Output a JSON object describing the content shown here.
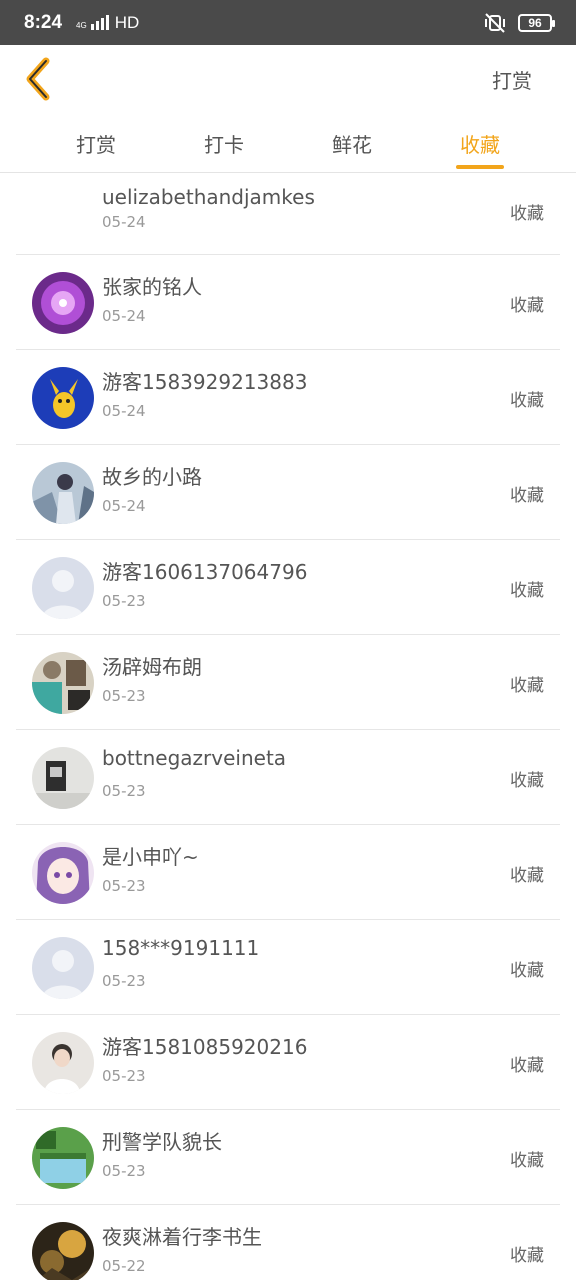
{
  "status_bar": {
    "time": "8:24",
    "network_small": "4G",
    "hd": "HD",
    "battery": "96"
  },
  "header": {
    "action_label": "打赏"
  },
  "tabs": [
    {
      "label": "打赏",
      "active": false
    },
    {
      "label": "打卡",
      "active": false
    },
    {
      "label": "鲜花",
      "active": false
    },
    {
      "label": "收藏",
      "active": true
    }
  ],
  "colors": {
    "accent": "#f2a51b",
    "status_bar_bg": "#4a4a4a"
  },
  "list": [
    {
      "name": "uelizabethandjamkes",
      "date": "05-24",
      "action": "收藏",
      "avatar": "none"
    },
    {
      "name": "张家的铭人",
      "date": "05-24",
      "action": "收藏",
      "avatar": "purple-flower"
    },
    {
      "name": "游客1583929213883",
      "date": "05-24",
      "action": "收藏",
      "avatar": "pikachu-blue"
    },
    {
      "name": "故乡的小路",
      "date": "05-24",
      "action": "收藏",
      "avatar": "girl-portrait"
    },
    {
      "name": "游客1606137064796",
      "date": "05-23",
      "action": "收藏",
      "avatar": "default-silhouette"
    },
    {
      "name": "汤辟姆布朗",
      "date": "05-23",
      "action": "收藏",
      "avatar": "abstract-teal"
    },
    {
      "name": "bottnegazrveineta",
      "date": "05-23",
      "action": "收藏",
      "avatar": "grey-photo"
    },
    {
      "name": "是小申吖~",
      "date": "05-23",
      "action": "收藏",
      "avatar": "anime-girl-purple"
    },
    {
      "name": "158***9191111",
      "date": "05-23",
      "action": "收藏",
      "avatar": "default-silhouette"
    },
    {
      "name": "游客1581085920216",
      "date": "05-23",
      "action": "收藏",
      "avatar": "boy-white"
    },
    {
      "name": "刑警学队貌长",
      "date": "05-23",
      "action": "收藏",
      "avatar": "green-book"
    },
    {
      "name": "夜爽淋着行李书生",
      "date": "05-22",
      "action": "收藏",
      "avatar": "golden-scene"
    }
  ]
}
